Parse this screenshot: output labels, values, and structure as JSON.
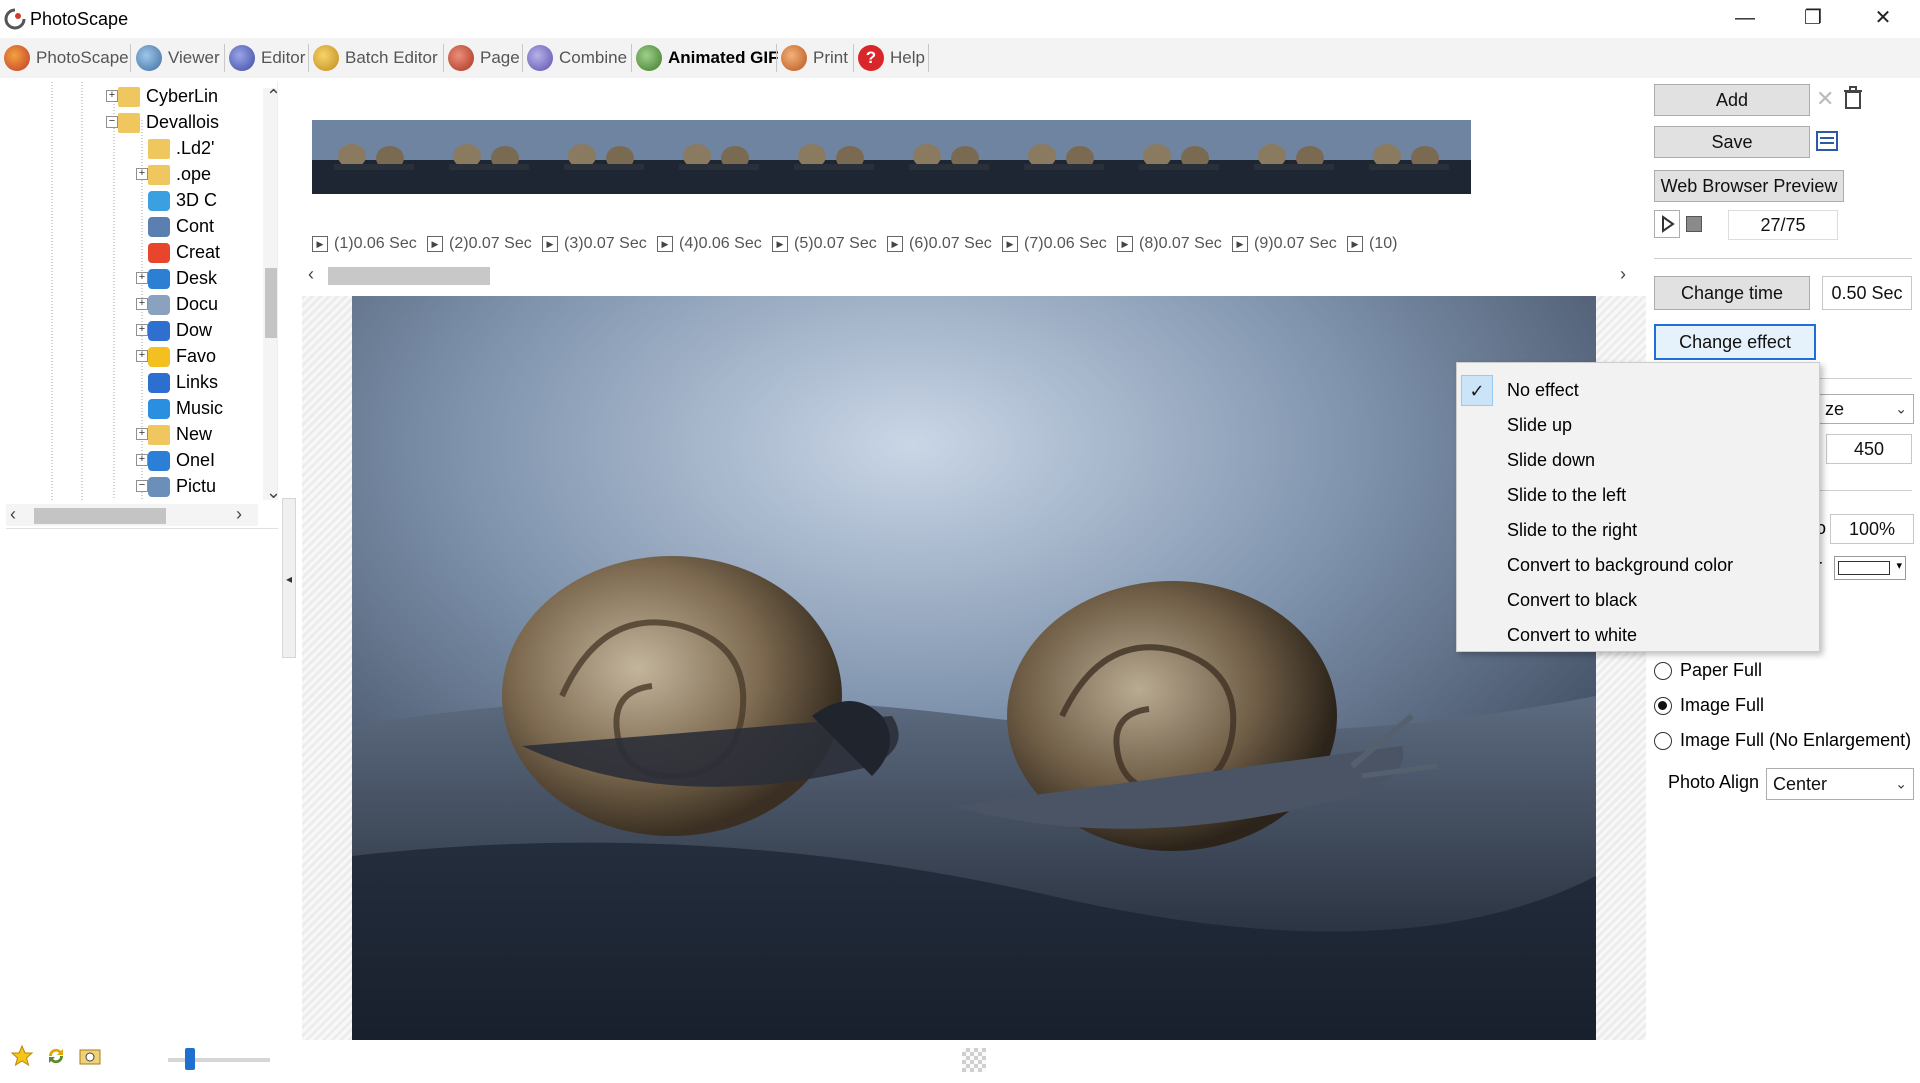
{
  "window": {
    "title": "PhotoScape",
    "controls": {
      "minimize": "—",
      "restore": "❐",
      "close": "✕"
    }
  },
  "tabs": [
    {
      "label": "PhotoScape",
      "icon": "photoscape-icon",
      "active": false
    },
    {
      "label": "Viewer",
      "icon": "viewer-icon",
      "active": false
    },
    {
      "label": "Editor",
      "icon": "editor-icon",
      "active": false
    },
    {
      "label": "Batch Editor",
      "icon": "batch-editor-icon",
      "active": false
    },
    {
      "label": "Page",
      "icon": "page-icon",
      "active": false
    },
    {
      "label": "Combine",
      "icon": "combine-icon",
      "active": false
    },
    {
      "label": "Animated GIF",
      "icon": "animated-gif-icon",
      "active": true
    },
    {
      "label": "Print",
      "icon": "print-icon",
      "active": false
    },
    {
      "label": "Help",
      "icon": "help-icon",
      "active": false
    }
  ],
  "tree": {
    "items": [
      {
        "label": "CyberLin",
        "icon": "folder-icon"
      },
      {
        "label": "Devallois",
        "icon": "folder-icon"
      },
      {
        "label": ".Ld2'",
        "icon": "folder-icon"
      },
      {
        "label": ".ope",
        "icon": "folder-icon"
      },
      {
        "label": "3D C",
        "icon": "3d-objects-icon"
      },
      {
        "label": "Cont",
        "icon": "contacts-icon"
      },
      {
        "label": "Creat",
        "icon": "creative-cloud-icon"
      },
      {
        "label": "Desk",
        "icon": "desktop-icon"
      },
      {
        "label": "Docu",
        "icon": "documents-icon"
      },
      {
        "label": "Dow",
        "icon": "downloads-icon"
      },
      {
        "label": "Favo",
        "icon": "favorites-icon"
      },
      {
        "label": "Links",
        "icon": "links-icon"
      },
      {
        "label": "Music",
        "icon": "music-icon"
      },
      {
        "label": "New",
        "icon": "folder-icon"
      },
      {
        "label": "OneI",
        "icon": "onedrive-icon"
      },
      {
        "label": "Pictu",
        "icon": "pictures-icon"
      }
    ]
  },
  "frames": [
    {
      "index": "(1)",
      "time": "0.06 Sec"
    },
    {
      "index": "(2)",
      "time": "0.07 Sec"
    },
    {
      "index": "(3)",
      "time": "0.07 Sec"
    },
    {
      "index": "(4)",
      "time": "0.06 Sec"
    },
    {
      "index": "(5)",
      "time": "0.07 Sec"
    },
    {
      "index": "(6)",
      "time": "0.07 Sec"
    },
    {
      "index": "(7)",
      "time": "0.06 Sec"
    },
    {
      "index": "(8)",
      "time": "0.07 Sec"
    },
    {
      "index": "(9)",
      "time": "0.07 Sec"
    },
    {
      "index": "(10)",
      "time": ""
    }
  ],
  "right": {
    "add_label": "Add",
    "save_label": "Save",
    "web_preview_label": "Web Browser Preview",
    "frame_counter": "27/75",
    "change_time_label": "Change time",
    "time_value": "0.50 Sec",
    "change_effect_label": "Change effect",
    "size_select_partial": "ze",
    "height_value": "450",
    "percent_value": "100%",
    "color_label_partial": "r",
    "radios": [
      {
        "label": "Paper Full",
        "checked": false
      },
      {
        "label": "Image Full",
        "checked": true
      },
      {
        "label": "Image Full (No Enlargement)",
        "checked": false
      }
    ],
    "photo_align_label": "Photo Align",
    "photo_align_value": "Center"
  },
  "effect_menu": {
    "items": [
      {
        "label": "No effect",
        "checked": true
      },
      {
        "label": "Slide up",
        "checked": false
      },
      {
        "label": "Slide down",
        "checked": false
      },
      {
        "label": "Slide to the left",
        "checked": false
      },
      {
        "label": "Slide to the right",
        "checked": false
      },
      {
        "label": "Convert to background color",
        "checked": false
      },
      {
        "label": "Convert to black",
        "checked": false
      },
      {
        "label": "Convert to white",
        "checked": false
      }
    ],
    "check_glyph": "✓"
  },
  "colors": {
    "accent": "#1f6fd6",
    "menu_bg": "#f2f2f2",
    "button_bg": "#e1e1e1"
  }
}
